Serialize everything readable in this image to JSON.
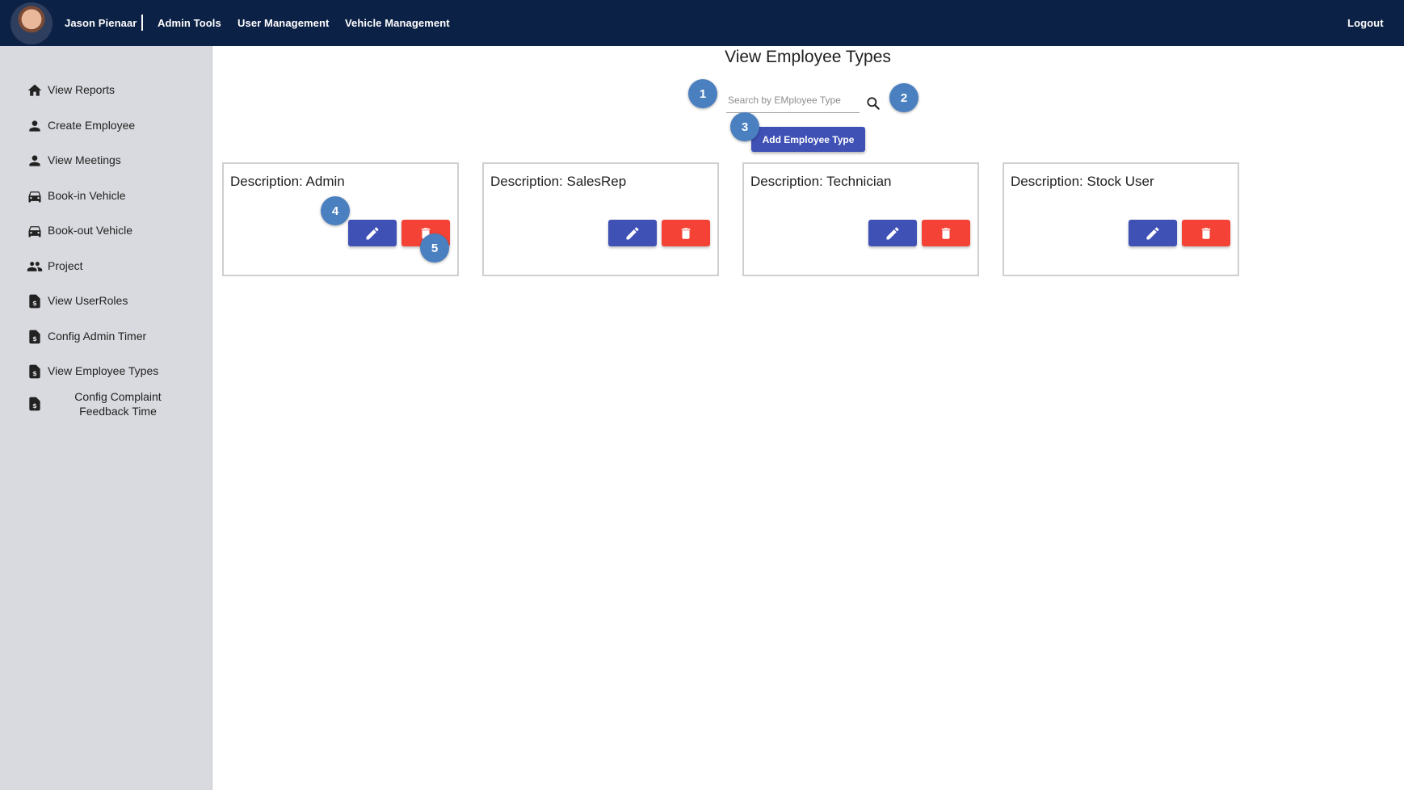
{
  "header": {
    "user_name": "Jason Pienaar",
    "separator": "|",
    "nav": [
      "Admin Tools",
      "User Management",
      "Vehicle Management"
    ],
    "logout": "Logout"
  },
  "sidebar": {
    "items": [
      {
        "label": "View Reports",
        "icon": "home-icon"
      },
      {
        "label": "Create Employee",
        "icon": "person-icon"
      },
      {
        "label": "View Meetings",
        "icon": "person-icon"
      },
      {
        "label": "Book-in Vehicle",
        "icon": "car-icon"
      },
      {
        "label": "Book-out Vehicle",
        "icon": "car-icon"
      },
      {
        "label": "Project",
        "icon": "group-icon"
      },
      {
        "label": "View UserRoles",
        "icon": "document-dollar-icon"
      },
      {
        "label": "Config Admin Timer",
        "icon": "document-dollar-icon"
      },
      {
        "label": "View Employee Types",
        "icon": "document-dollar-icon"
      },
      {
        "label": "Config Complaint Feedback Time",
        "icon": "document-dollar-icon"
      }
    ]
  },
  "main": {
    "title": "View Employee Types",
    "search": {
      "placeholder": "Search by EMployee Type",
      "value": ""
    },
    "add_button": "Add Employee Type",
    "cards": [
      {
        "description": "Description: Admin"
      },
      {
        "description": "Description: SalesRep"
      },
      {
        "description": "Description: Technician"
      },
      {
        "description": "Description: Stock User"
      }
    ]
  },
  "annotations": [
    "1",
    "2",
    "3",
    "4",
    "5"
  ],
  "colors": {
    "header_bg": "#0c2146",
    "sidebar_bg": "#d9dadf",
    "primary": "#3f51b5",
    "danger": "#f44336",
    "badge": "#4a7fc0"
  }
}
